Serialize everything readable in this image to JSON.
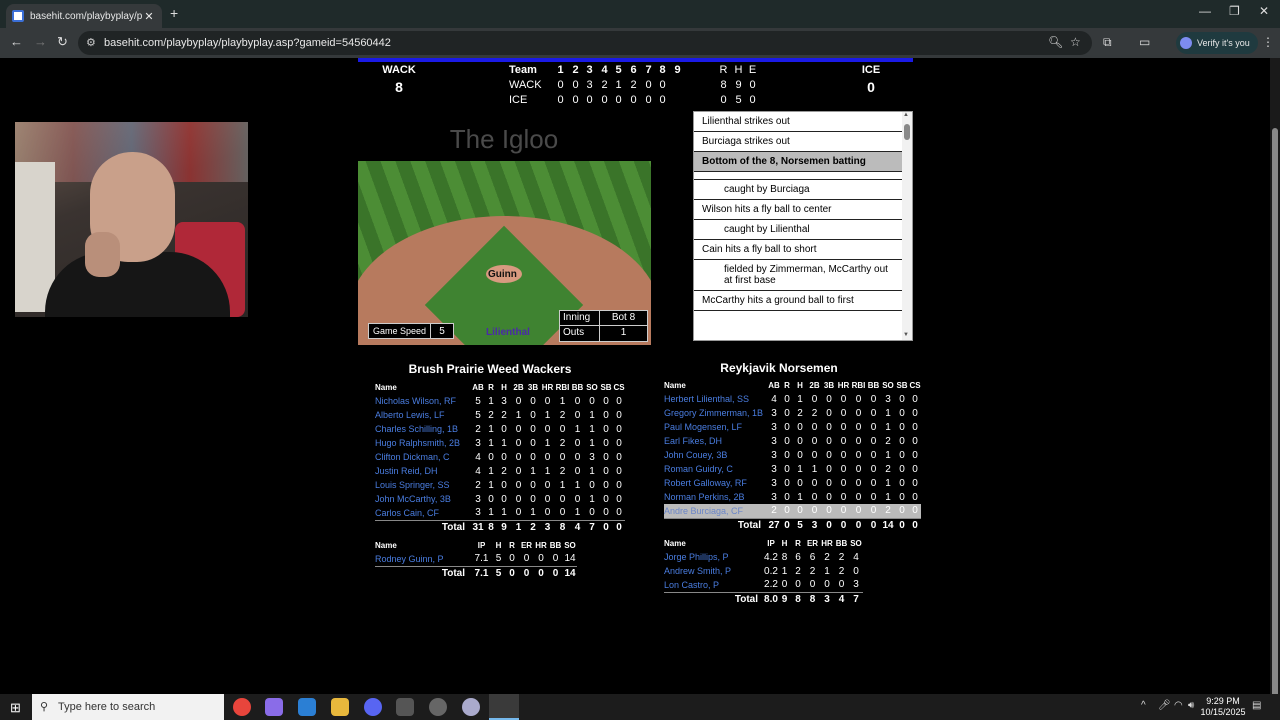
{
  "browser": {
    "tab_title": "basehit.com/playbyplay/playby",
    "tab_close": "✕",
    "new_tab": "+",
    "url": "basehit.com/playbyplay/playbyplay.asp?gameid=54560442",
    "verify_label": "Verify it's you",
    "win_min": "—",
    "win_max": "❐",
    "win_close": "✕"
  },
  "scoreboard": {
    "away_abbr": "WACK",
    "away_score": "8",
    "home_abbr": "ICE",
    "home_score": "0",
    "header": {
      "team": "Team",
      "innings": [
        "1",
        "2",
        "3",
        "4",
        "5",
        "6",
        "7",
        "8",
        "9"
      ],
      "r": "R",
      "h": "H",
      "e": "E"
    },
    "rows": [
      {
        "team": "WACK",
        "innings": [
          "0",
          "0",
          "3",
          "2",
          "1",
          "2",
          "0",
          "0",
          ""
        ],
        "r": "8",
        "h": "9",
        "e": "0"
      },
      {
        "team": "ICE",
        "innings": [
          "0",
          "0",
          "0",
          "0",
          "0",
          "0",
          "0",
          "0",
          ""
        ],
        "r": "0",
        "h": "5",
        "e": "0"
      }
    ]
  },
  "stadium": {
    "name": "The Igloo",
    "pitcher": "Guinn",
    "batter": "Lilienthal",
    "game_speed_label": "Game Speed",
    "game_speed": "5",
    "inning_label": "Inning",
    "inning": "Bot 8",
    "outs_label": "Outs",
    "outs": "1"
  },
  "play_log": [
    {
      "text": "Lilienthal strikes out",
      "kind": "normal"
    },
    {
      "text": "Burciaga strikes out",
      "kind": "normal"
    },
    {
      "text": "Bottom of the 8, Norsemen batting",
      "kind": "head"
    },
    {
      "text": "",
      "kind": "gap"
    },
    {
      "text": "caught by Burciaga",
      "kind": "indent"
    },
    {
      "text": "Wilson hits a fly ball to center",
      "kind": "normal"
    },
    {
      "text": "caught by Lilienthal",
      "kind": "indent"
    },
    {
      "text": "Cain hits a fly ball to short",
      "kind": "normal"
    },
    {
      "text": "fielded by Zimmerman, McCarthy out at first base",
      "kind": "indent"
    },
    {
      "text": "McCarthy hits a ground ball to first",
      "kind": "normal"
    }
  ],
  "away_team": {
    "name": "Brush Prairie Weed Wackers",
    "bat_headers": [
      "Name",
      "AB",
      "R",
      "H",
      "2B",
      "3B",
      "HR",
      "RBI",
      "BB",
      "SO",
      "SB",
      "CS"
    ],
    "batters": [
      [
        "Nicholas Wilson, RF",
        "5",
        "1",
        "3",
        "0",
        "0",
        "0",
        "1",
        "0",
        "0",
        "0",
        "0"
      ],
      [
        "Alberto Lewis, LF",
        "5",
        "2",
        "2",
        "1",
        "0",
        "1",
        "2",
        "0",
        "1",
        "0",
        "0"
      ],
      [
        "Charles Schilling, 1B",
        "2",
        "1",
        "0",
        "0",
        "0",
        "0",
        "0",
        "1",
        "1",
        "0",
        "0"
      ],
      [
        "Hugo Ralphsmith, 2B",
        "3",
        "1",
        "1",
        "0",
        "0",
        "1",
        "2",
        "0",
        "1",
        "0",
        "0"
      ],
      [
        "Clifton Dickman, C",
        "4",
        "0",
        "0",
        "0",
        "0",
        "0",
        "0",
        "0",
        "3",
        "0",
        "0"
      ],
      [
        "Justin Reid, DH",
        "4",
        "1",
        "2",
        "0",
        "1",
        "1",
        "2",
        "0",
        "1",
        "0",
        "0"
      ],
      [
        "Louis Springer, SS",
        "2",
        "1",
        "0",
        "0",
        "0",
        "0",
        "1",
        "1",
        "0",
        "0",
        "0"
      ],
      [
        "John McCarthy, 3B",
        "3",
        "0",
        "0",
        "0",
        "0",
        "0",
        "0",
        "0",
        "1",
        "0",
        "0"
      ],
      [
        "Carlos Cain, CF",
        "3",
        "1",
        "1",
        "0",
        "1",
        "0",
        "0",
        "1",
        "0",
        "0",
        "0"
      ]
    ],
    "bat_total": [
      "Total",
      "31",
      "8",
      "9",
      "1",
      "2",
      "3",
      "8",
      "4",
      "7",
      "0",
      "0"
    ],
    "pit_headers": [
      "Name",
      "IP",
      "H",
      "R",
      "ER",
      "HR",
      "BB",
      "SO"
    ],
    "pitchers": [
      [
        "Rodney Guinn, P",
        "7.1",
        "5",
        "0",
        "0",
        "0",
        "0",
        "14"
      ]
    ],
    "pit_total": [
      "Total",
      "7.1",
      "5",
      "0",
      "0",
      "0",
      "0",
      "14"
    ]
  },
  "home_team": {
    "name": "Reykjavik Norsemen",
    "bat_headers": [
      "Name",
      "AB",
      "R",
      "H",
      "2B",
      "3B",
      "HR",
      "RBI",
      "BB",
      "SO",
      "SB",
      "CS"
    ],
    "batters": [
      [
        "Herbert Lilienthal, SS",
        "4",
        "0",
        "1",
        "0",
        "0",
        "0",
        "0",
        "0",
        "3",
        "0",
        "0"
      ],
      [
        "Gregory Zimmerman, 1B",
        "3",
        "0",
        "2",
        "2",
        "0",
        "0",
        "0",
        "0",
        "1",
        "0",
        "0"
      ],
      [
        "Paul Mogensen, LF",
        "3",
        "0",
        "0",
        "0",
        "0",
        "0",
        "0",
        "0",
        "1",
        "0",
        "0"
      ],
      [
        "Earl Fikes, DH",
        "3",
        "0",
        "0",
        "0",
        "0",
        "0",
        "0",
        "0",
        "2",
        "0",
        "0"
      ],
      [
        "John Couey, 3B",
        "3",
        "0",
        "0",
        "0",
        "0",
        "0",
        "0",
        "0",
        "1",
        "0",
        "0"
      ],
      [
        "Roman Guidry, C",
        "3",
        "0",
        "1",
        "1",
        "0",
        "0",
        "0",
        "0",
        "2",
        "0",
        "0"
      ],
      [
        "Robert Galloway, RF",
        "3",
        "0",
        "0",
        "0",
        "0",
        "0",
        "0",
        "0",
        "1",
        "0",
        "0"
      ],
      [
        "Norman Perkins, 2B",
        "3",
        "0",
        "1",
        "0",
        "0",
        "0",
        "0",
        "0",
        "1",
        "0",
        "0"
      ],
      [
        "Andre Burciaga, CF",
        "2",
        "0",
        "0",
        "0",
        "0",
        "0",
        "0",
        "0",
        "2",
        "0",
        "0"
      ]
    ],
    "highlight_row": 8,
    "bat_total": [
      "Total",
      "27",
      "0",
      "5",
      "3",
      "0",
      "0",
      "0",
      "0",
      "14",
      "0",
      "0"
    ],
    "pit_headers": [
      "Name",
      "IP",
      "H",
      "R",
      "ER",
      "HR",
      "BB",
      "SO"
    ],
    "pitchers": [
      [
        "Jorge Phillips, P",
        "4.2",
        "8",
        "6",
        "6",
        "2",
        "2",
        "4"
      ],
      [
        "Andrew Smith, P",
        "0.2",
        "1",
        "2",
        "2",
        "1",
        "2",
        "0"
      ],
      [
        "Lon Castro, P",
        "2.2",
        "0",
        "0",
        "0",
        "0",
        "0",
        "3"
      ]
    ],
    "pit_total": [
      "Total",
      "8.0",
      "9",
      "8",
      "8",
      "3",
      "4",
      "7"
    ]
  },
  "taskbar": {
    "search_placeholder": "Type here to search",
    "time": "9:29 PM",
    "date": "10/15/2025"
  },
  "colors": {
    "accent_bar": "#1a1ae6",
    "link": "#4a7de0",
    "batter_name": "#4b2aa8"
  }
}
